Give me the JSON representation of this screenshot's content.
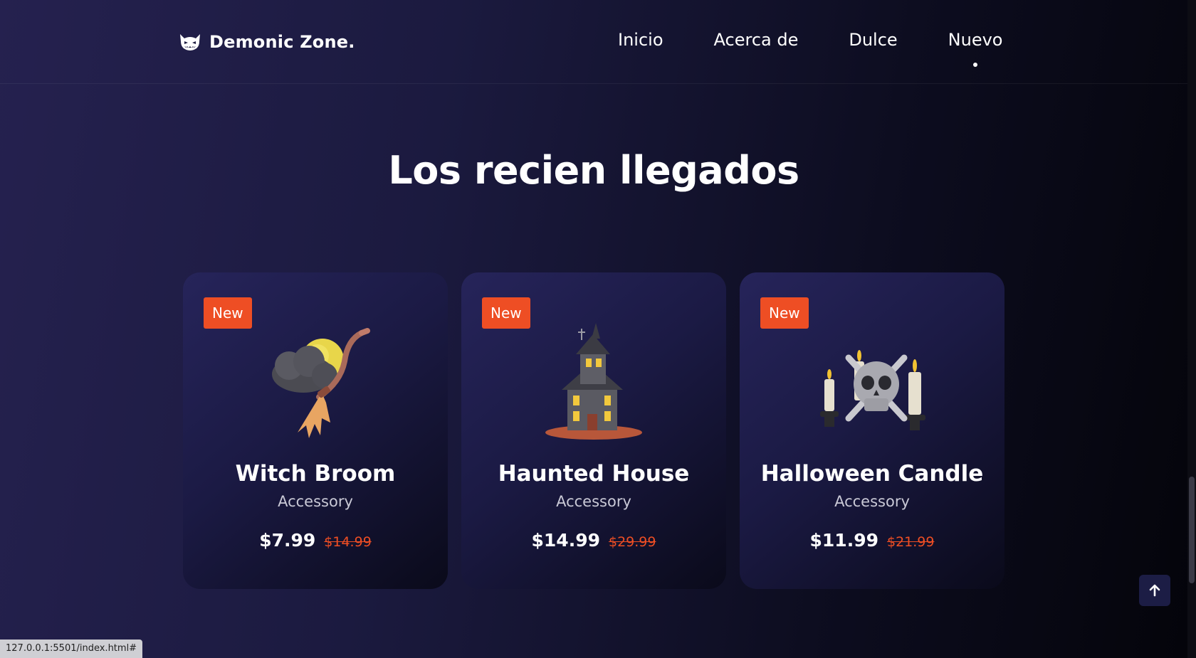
{
  "brand": {
    "name": "Demonic Zone.",
    "icon": "demon-face-icon"
  },
  "nav": {
    "items": [
      {
        "label": "Inicio"
      },
      {
        "label": "Acerca de"
      },
      {
        "label": "Dulce"
      },
      {
        "label": "Nuevo",
        "active": true
      }
    ]
  },
  "section": {
    "title": "Los recien llegados"
  },
  "products": [
    {
      "badge": "New",
      "name": "Witch Broom",
      "category": "Accessory",
      "price": "$7.99",
      "old_price": "$14.99",
      "icon": "witch-broom-icon"
    },
    {
      "badge": "New",
      "name": "Haunted House",
      "category": "Accessory",
      "price": "$14.99",
      "old_price": "$29.99",
      "icon": "haunted-house-icon"
    },
    {
      "badge": "New",
      "name": "Halloween Candle",
      "category": "Accessory",
      "price": "$11.99",
      "old_price": "$21.99",
      "icon": "skull-candle-icon"
    }
  ],
  "scroll_top": {
    "icon": "arrow-up-icon"
  },
  "status": {
    "url": "127.0.0.1:5501/index.html#"
  },
  "colors": {
    "accent": "#ee4e24",
    "background": "#1b1a3f"
  }
}
